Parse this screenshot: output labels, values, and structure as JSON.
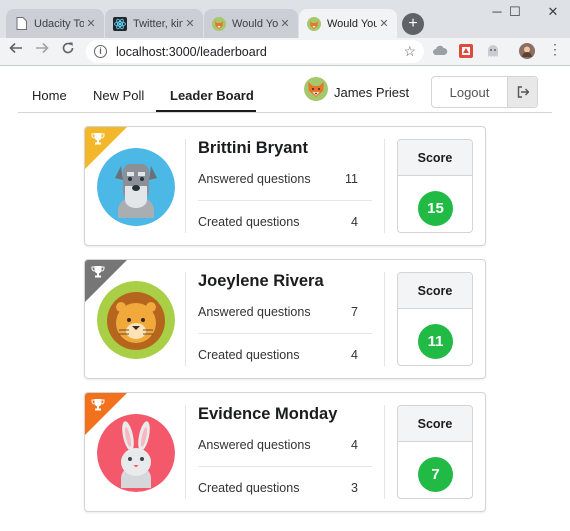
{
  "browser": {
    "tabs": [
      {
        "title": "Udacity Too",
        "close": "✕"
      },
      {
        "title": "Twitter, kin",
        "close": "✕"
      },
      {
        "title": "Would You",
        "close": "✕"
      },
      {
        "title": "Would You",
        "close": "✕"
      }
    ],
    "new_tab": "+",
    "window_controls": {
      "minimize": "─",
      "maximize": "☐",
      "close": "✕"
    },
    "url": "localhost:3000/leaderboard"
  },
  "nav": {
    "home": "Home",
    "new_poll": "New Poll",
    "leader_board": "Leader Board",
    "active_item": "Leader Board",
    "user_name": "James Priest",
    "logout": "Logout"
  },
  "leaderboard": [
    {
      "name": "Brittini Bryant",
      "answered_label": "Answered questions",
      "answered": "11",
      "created_label": "Created questions",
      "created": "4",
      "score_label": "Score",
      "score": "15",
      "ribbon_color": "#f2b82a",
      "avatar": "schnauzer-dog"
    },
    {
      "name": "Joeylene Rivera",
      "answered_label": "Answered questions",
      "answered": "7",
      "created_label": "Created questions",
      "created": "4",
      "score_label": "Score",
      "score": "11",
      "ribbon_color": "#767676",
      "avatar": "lion"
    },
    {
      "name": "Evidence Monday",
      "answered_label": "Answered questions",
      "answered": "4",
      "created_label": "Created questions",
      "created": "3",
      "score_label": "Score",
      "score": "7",
      "ribbon_color": "#f2711c",
      "avatar": "rabbit"
    }
  ],
  "colors": {
    "score_badge": "#21ba45",
    "chrome_frame": "#dee1e6"
  }
}
